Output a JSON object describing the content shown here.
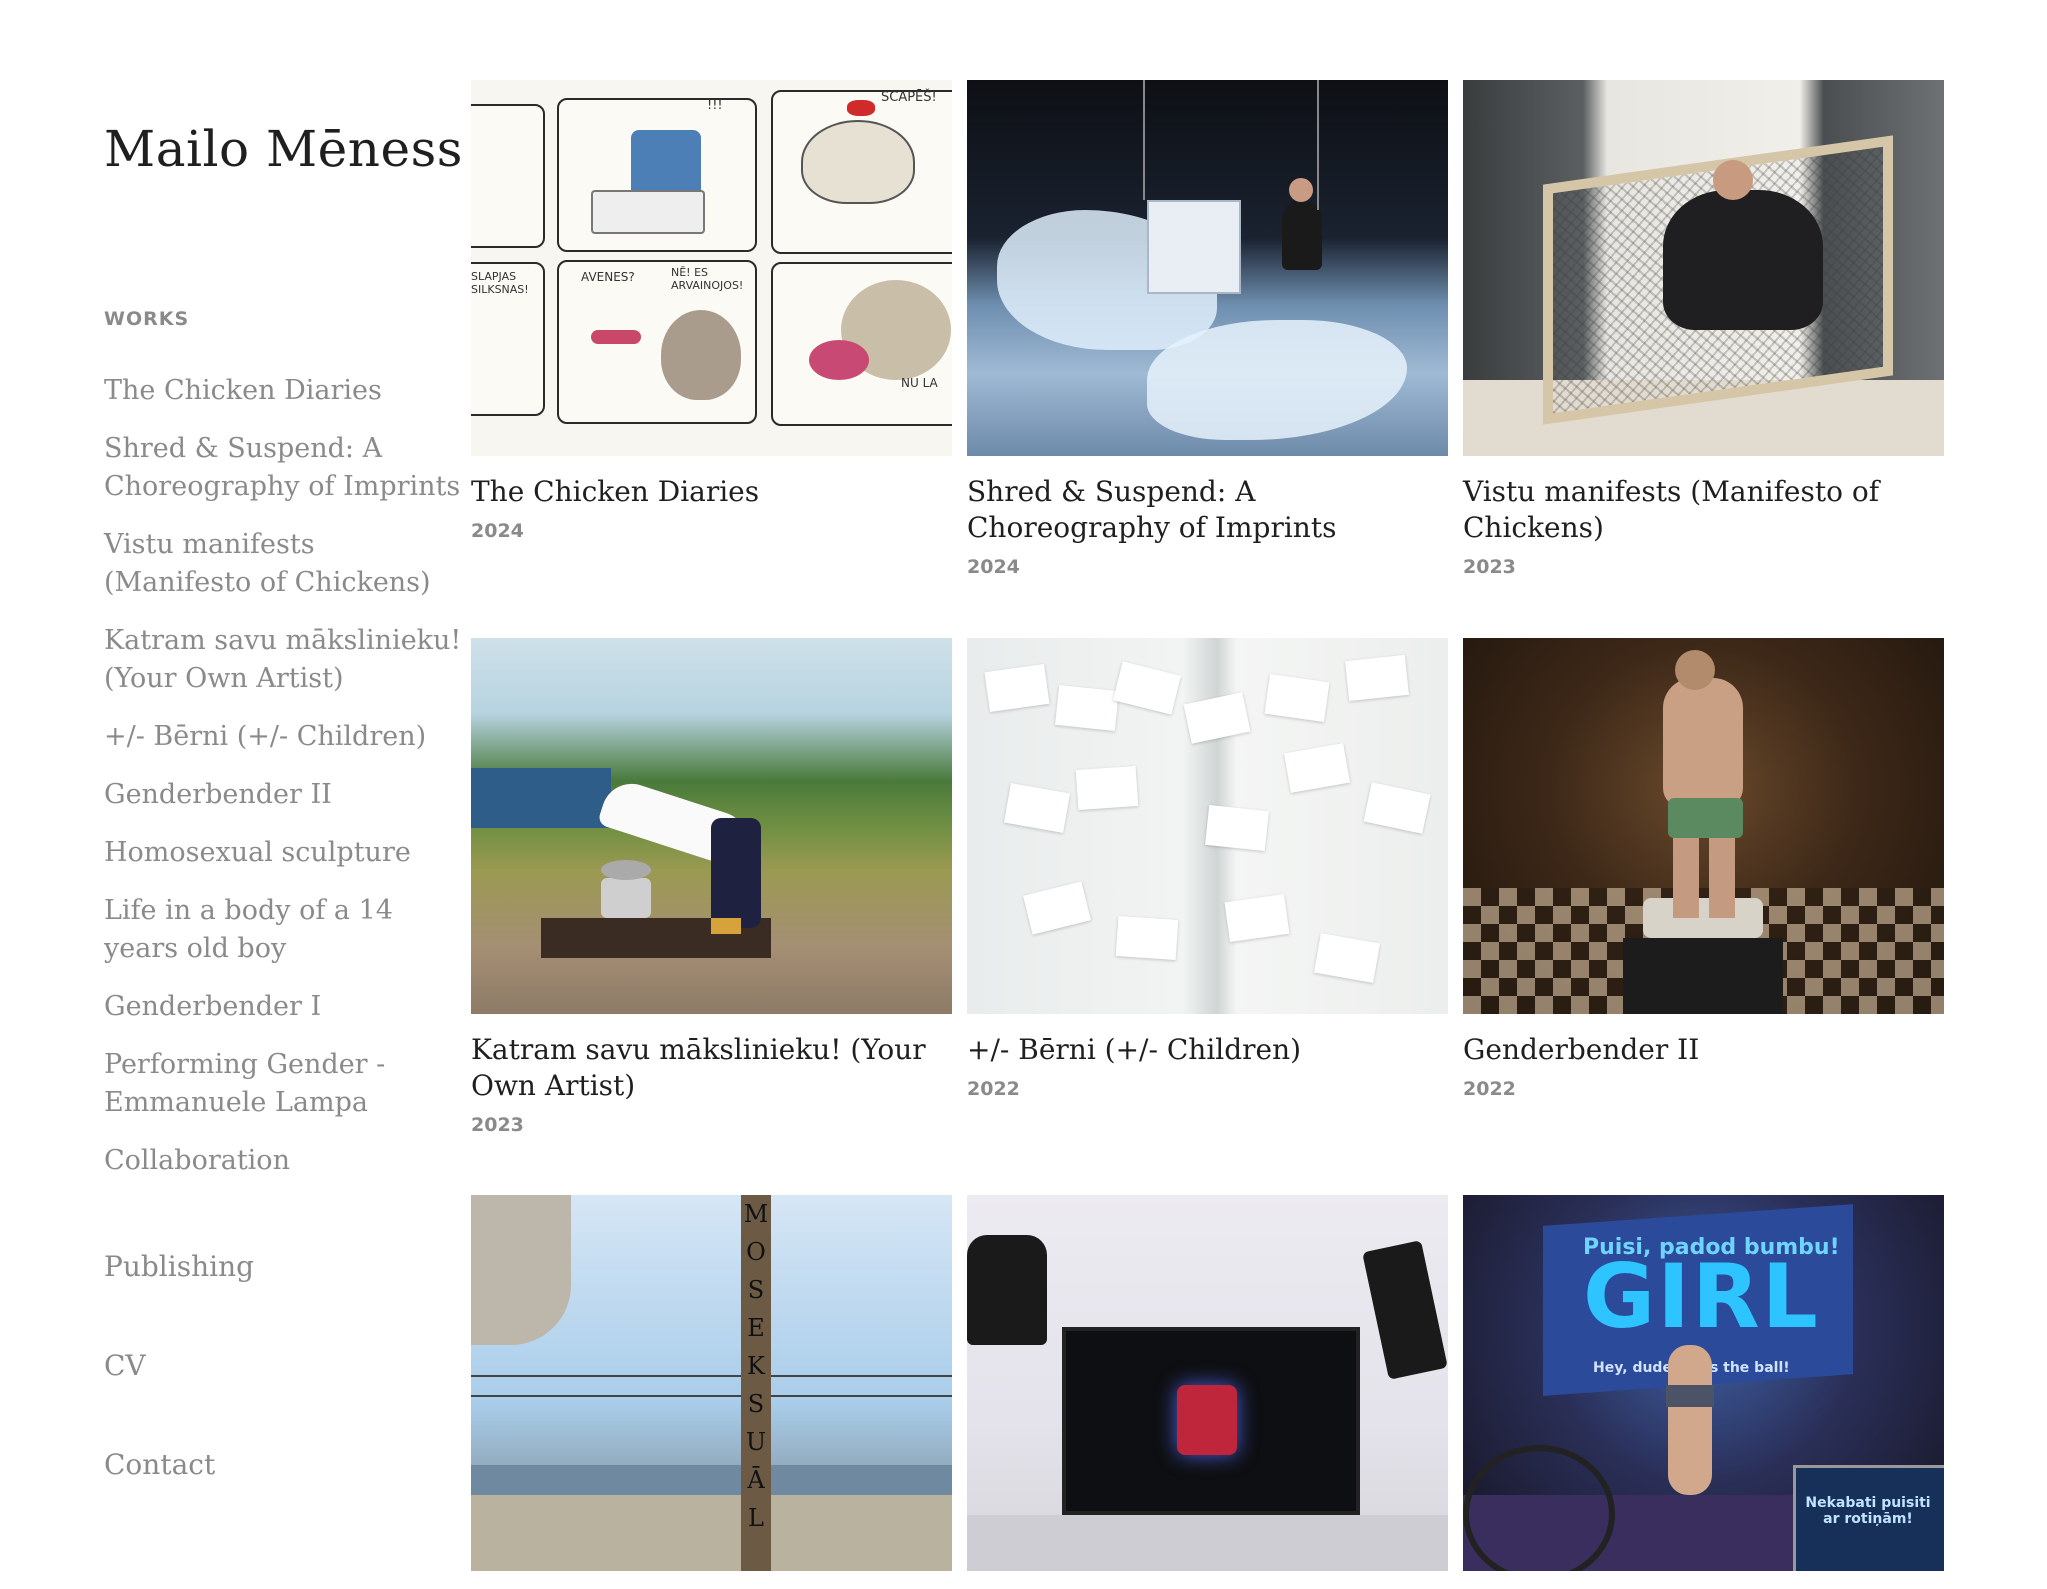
{
  "site": {
    "title": "Mailo Mēness"
  },
  "sidebar": {
    "section_label": "WORKS",
    "works": [
      "The Chicken Diaries",
      "Shred & Suspend: A Choreography of Imprints",
      "Vistu manifests (Manifesto of Chickens)",
      "Katram savu mākslinieku! (Your Own Artist)",
      "+/- Bērni (+/- Children)",
      "Genderbender II",
      "Homosexual sculpture",
      "Life in a body of a 14 years old boy",
      "Genderbender I",
      "Performing Gender - Emmanuele Lampa",
      "Collaboration"
    ],
    "links": {
      "publishing": "Publishing",
      "cv": "CV",
      "contact": "Contact"
    }
  },
  "grid": {
    "cards": [
      {
        "title": "The Chicken Diaries",
        "year": "2024"
      },
      {
        "title": "Shred & Suspend: A Choreography of Imprints",
        "year": "2024"
      },
      {
        "title": "Vistu manifests (Manifesto of Chickens)",
        "year": "2023"
      },
      {
        "title": "Katram savu mākslinieku! (Your Own Artist)",
        "year": "2023"
      },
      {
        "title": "+/- Bērni (+/- Children)",
        "year": "2022"
      },
      {
        "title": "Genderbender II",
        "year": "2022"
      },
      {
        "title": "",
        "year": ""
      },
      {
        "title": "",
        "year": ""
      },
      {
        "title": "",
        "year": ""
      }
    ],
    "thumb_texts": {
      "comic_1": "SCAPĒŠ!",
      "comic_2": "SLAPJAS SILKSNAS!",
      "comic_3": "AVENES?",
      "comic_4": "NĒ! ES ARVAINOJOS!",
      "comic_5": "NU LA",
      "comic_6": "!!!",
      "pillar": "MOSEKSUĀL",
      "screen_big": "GIRL",
      "screen_top": "Puisi, padod bumbu!",
      "screen_bottom": "Hey, dude, pass the ball!",
      "sign": "Nekabati puisiti ar rotiņām!"
    }
  },
  "colors": {
    "background": "#ffffff",
    "title_text": "#1f1f1f",
    "muted_text": "#8a8a8a"
  }
}
